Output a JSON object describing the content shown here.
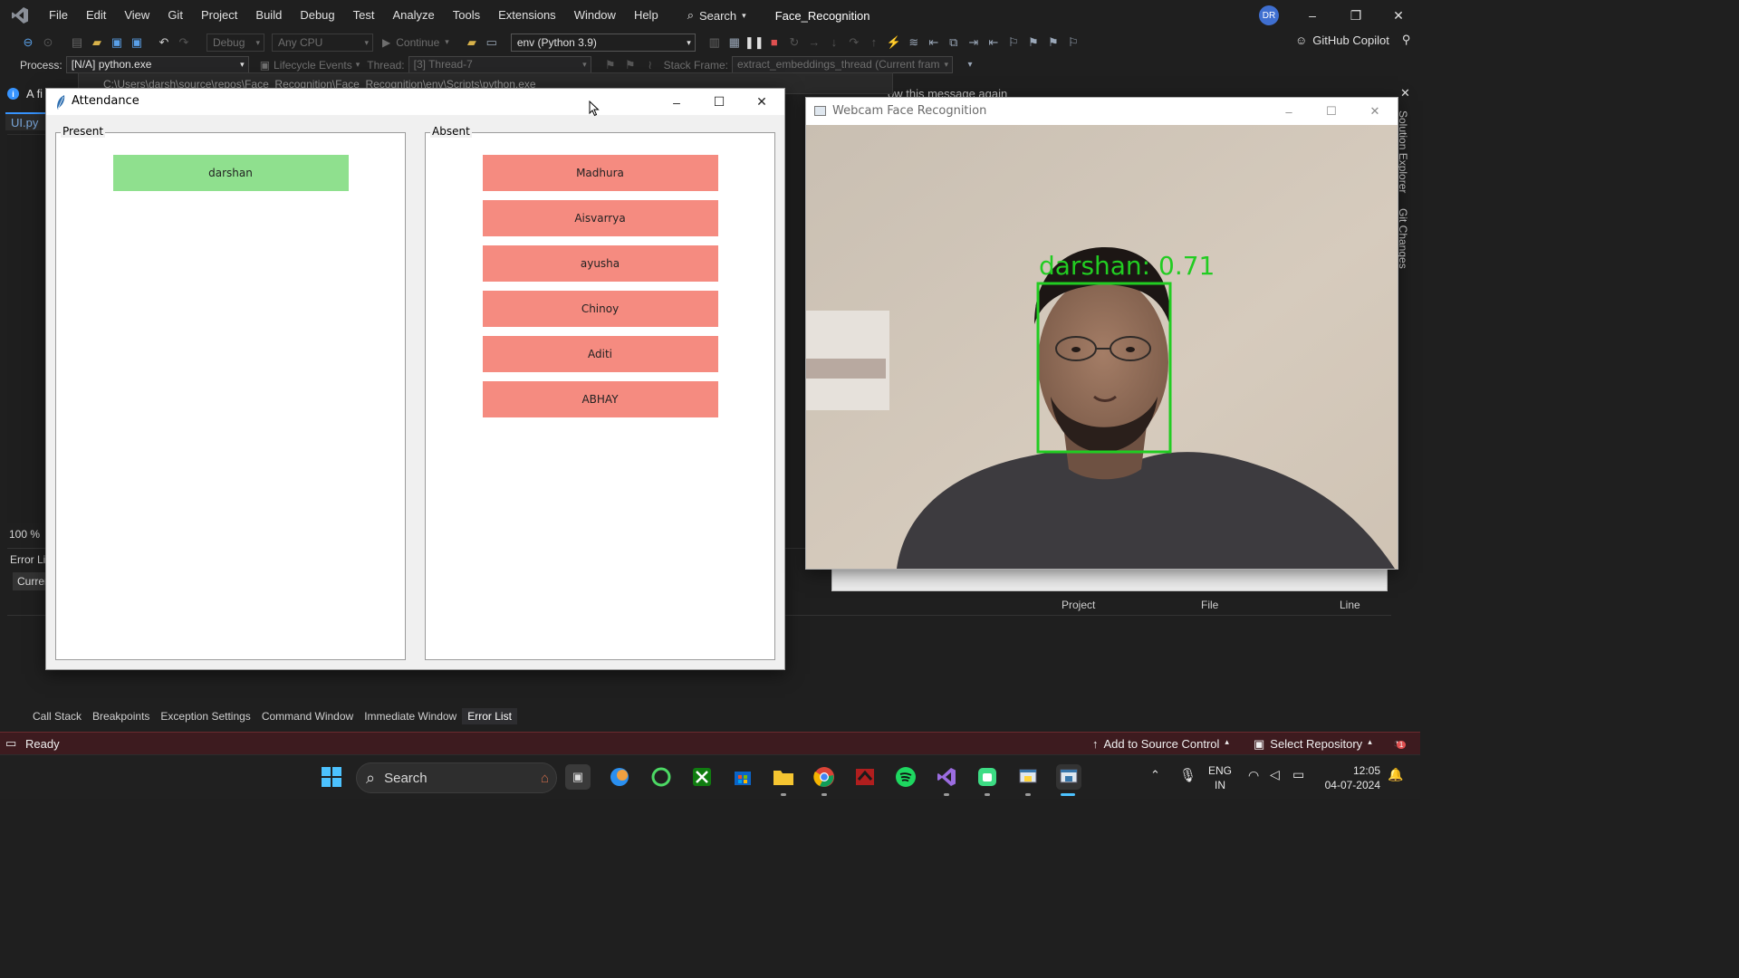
{
  "vs": {
    "menu": [
      "File",
      "Edit",
      "View",
      "Git",
      "Project",
      "Build",
      "Debug",
      "Test",
      "Analyze",
      "Tools",
      "Extensions",
      "Window",
      "Help"
    ],
    "search_label": "Search",
    "solution_name": "Face_Recognition",
    "user_initials": "DR",
    "toolbar": {
      "config": "Debug",
      "platform": "Any CPU",
      "continue": "Continue",
      "environment": "env (Python 3.9)",
      "copilot": "GitHub Copilot"
    },
    "debugbar": {
      "process_label": "Process:",
      "process_value": "[N/A] python.exe",
      "lifecycle": "Lifecycle Events",
      "thread_label": "Thread:",
      "thread_value": "[3] Thread-7",
      "stackframe_label": "Stack Frame:",
      "stackframe_value": "extract_embeddings_thread (Current fram"
    },
    "console_title": "C:\\Users\\darsh\\source\\repos\\Face_Recognition\\Face_Recognition\\env\\Scripts\\python.exe",
    "info_text": "A fi",
    "info_dont_show": "ow this message again",
    "editor_tab": "UI.py",
    "zoom": "100 %",
    "error_list": {
      "title": "Error Li",
      "filter": "Curren",
      "columns": [
        "Project",
        "File",
        "Line"
      ]
    },
    "debug_tabs": [
      "Call Stack",
      "Breakpoints",
      "Exception Settings",
      "Command Window",
      "Immediate Window",
      "Error List"
    ],
    "right_dock": [
      "Solution Explorer",
      "Git Changes"
    ],
    "status": {
      "ready": "Ready",
      "add_source_control": "Add to Source Control",
      "select_repository": "Select Repository",
      "notifications": "1"
    }
  },
  "attendance": {
    "window_title": "Attendance",
    "present_label": "Present",
    "absent_label": "Absent",
    "present": [
      "darshan"
    ],
    "absent": [
      "Madhura",
      "Aisvarrya",
      "ayusha",
      "Chinoy",
      "Aditi",
      "ABHAY"
    ],
    "colors": {
      "present": "#8fe08e",
      "absent": "#f58b80"
    }
  },
  "webcam": {
    "window_title": "Webcam Face Recognition",
    "detection_label": "darshan: 0.71",
    "box_color": "#22cc22"
  },
  "taskbar": {
    "search_label": "Search",
    "apps": [
      "start-icon",
      "task-view-icon",
      "copilot-icon",
      "refresh-app-icon",
      "xbox-icon",
      "store-icon",
      "file-explorer-icon",
      "chrome-icon",
      "red-app-icon",
      "spotify-icon",
      "visual-studio-icon",
      "android-app-icon",
      "python-app-icon",
      "python-tk-icon"
    ],
    "lang_top": "ENG",
    "lang_bottom": "IN",
    "time": "12:05",
    "date": "04-07-2024"
  }
}
